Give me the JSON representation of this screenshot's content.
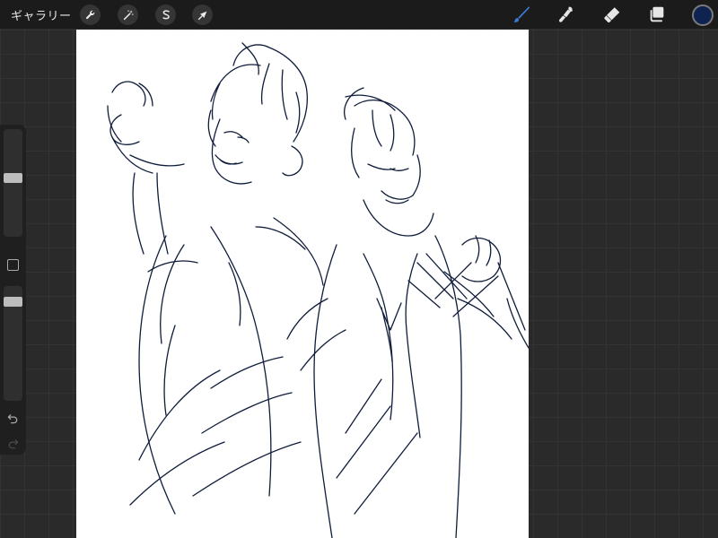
{
  "toolbar": {
    "gallery_label": "ギャラリー",
    "left_tools": [
      {
        "name": "actions",
        "icon": "wrench-icon"
      },
      {
        "name": "adjustments",
        "icon": "magic-wand-icon"
      },
      {
        "name": "selection",
        "icon": "selection-s-icon"
      },
      {
        "name": "transform",
        "icon": "arrow-cursor-icon"
      }
    ],
    "right_tools": [
      {
        "name": "brush",
        "icon": "brush-icon",
        "active": true
      },
      {
        "name": "smudge",
        "icon": "smudge-icon",
        "active": false
      },
      {
        "name": "eraser",
        "icon": "eraser-icon",
        "active": false
      },
      {
        "name": "layers",
        "icon": "layers-icon",
        "active": false
      }
    ],
    "current_color": "#0f2350",
    "active_tool_color": "#3a7bd5"
  },
  "sidebar": {
    "brush_size_level": 0.45,
    "opacity_level": 0.1,
    "undo_icon": "undo-icon",
    "redo_icon": "redo-icon",
    "modify_icon": "square-icon"
  },
  "canvas": {
    "background": "#ffffff",
    "stroke_color": "#0f1c3a",
    "content": "sketch-two-anime-characters"
  }
}
